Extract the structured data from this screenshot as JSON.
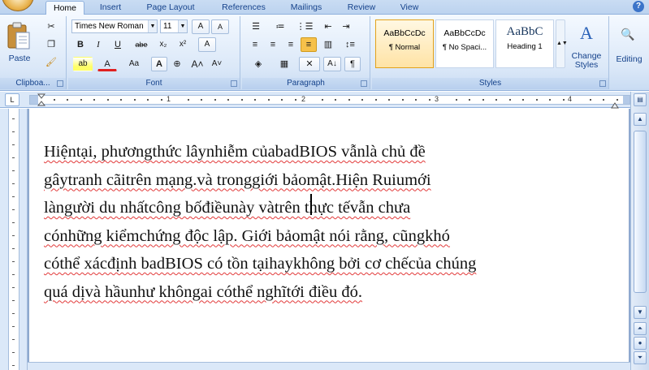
{
  "tabs": [
    "Home",
    "Insert",
    "Page Layout",
    "References",
    "Mailings",
    "Review",
    "View"
  ],
  "active_tab": "Home",
  "clipboard": {
    "paste_label": "Paste",
    "group_label": "Clipboa..."
  },
  "font": {
    "font_name": "Times New Roman",
    "font_size": "11",
    "group_label": "Font",
    "bold": "B",
    "italic": "I",
    "underline": "U",
    "strike": "abe",
    "subscript": "x₂",
    "superscript": "x²",
    "highlight": "ab",
    "font_color": "A",
    "change_case": "Aa",
    "grow": "A",
    "shrink": "A",
    "clear": "A"
  },
  "paragraph": {
    "group_label": "Paragraph"
  },
  "styles": {
    "group_label": "Styles",
    "items": [
      {
        "sample": "AaBbCcDc",
        "name": "¶ Normal",
        "selected": true
      },
      {
        "sample": "AaBbCcDc",
        "name": "¶ No Spaci...",
        "selected": false
      },
      {
        "sample": "AaBbC",
        "name": "Heading 1",
        "selected": false
      }
    ],
    "change_styles_label": "Change Styles",
    "editing_label": "Editing"
  },
  "ruler": {
    "numbers": [
      "1",
      "2",
      "3",
      "4"
    ]
  },
  "document": {
    "lines": [
      "Hiệntại, phươngthức lâynhiễm củabadBIOS vẫnlà chủ đề",
      "gâytranh cãitrên mạng.và tronggiới bảomật.Hiện Ruiumới",
      "làngười du nhấtcông bốđiềunày vàtrên thực tếvẫn chưa",
      "cónhững kiểmchứng độc lập. Giới bảomật nói rằng, cũngkhó",
      "cóthể xácđịnh badBIOS có tồn tạihaykhông bởi cơ chếcủa chúng",
      "quá dịvà hầunhư khôngai cóthể nghĩtới điều đó."
    ]
  },
  "colors": {
    "ribbon_blue": "#dbe8f8",
    "accent_text": "#15428b",
    "spell_underline": "#e23a3a",
    "selected_style": "#ffe3a5"
  }
}
